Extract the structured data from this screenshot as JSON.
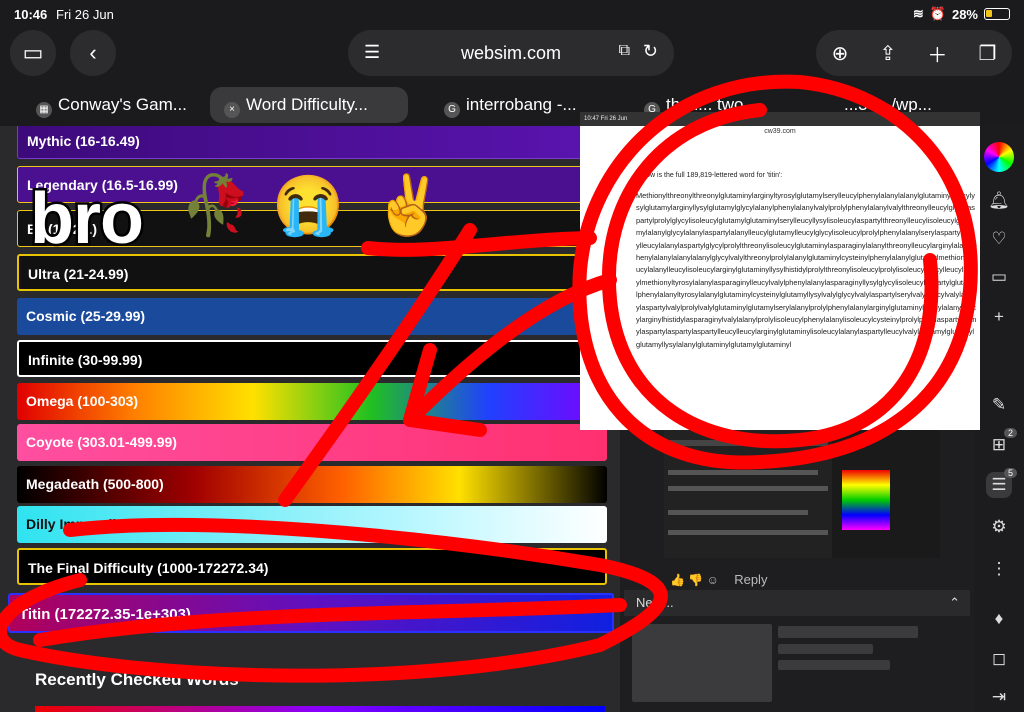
{
  "status": {
    "time": "10:46",
    "date": "Fri 26 Jun",
    "battery": "28%"
  },
  "toolbar": {
    "url": "websim.com"
  },
  "tabs": [
    {
      "label": "Conway's Gam..."
    },
    {
      "label": "Word Difficulty..."
    },
    {
      "label": "interrobang -..."
    },
    {
      "label": "the l...      two"
    },
    {
      "label": "...3 ... /wp..."
    }
  ],
  "difficulties": [
    {
      "label": "Mythic (16-16.49)"
    },
    {
      "label": "Legendary (16.5-16.99)"
    },
    {
      "label": "E...(17-20.)"
    },
    {
      "label": "Ultra (21-24.99)"
    },
    {
      "label": "Cosmic (25-29.99)"
    },
    {
      "label": "Infinite (30-99.99)"
    },
    {
      "label": "Omega (100-303)"
    },
    {
      "label": "Coyote (303.01-499.99)"
    },
    {
      "label": "Megadeath (500-800)"
    },
    {
      "label": "Dilly Impossible (800.01-999.99)"
    },
    {
      "label": "The Final Difficulty (1000-172272.34)"
    },
    {
      "label": "Titin (172272.35-1e+303)"
    }
  ],
  "recent_title": "Recently Checked Words",
  "overlay": {
    "caption": "bro",
    "emojis": [
      "🥀",
      "😭",
      "✌️"
    ],
    "shot_time": "10:47  Fri 26 Jun",
    "shot_url": "cw39.com",
    "shot_intro": "Below is the full 189,819-lettered word for 'titin':",
    "shot_text": "Methionylthreonylthreonylglutaminylarginyltyrosylglutamylserylleucylphenylalanylalanylglutaminylleucylysylglutamylarginyllysylglutamylglycylalanylphenylalanylvalylprolylphenylalanylvalylthreonylleucylglycylaspartylprolylglycylisoleucylglutamylglutaminylserylleucyllysylisoleucylaspartylthreonylleucylisoleucylglutamylalanylglycylalanylaspartylalanylleucylglutamylleucylglycylisoleucylprolylphenylalanylserylaspartylprolylleucylalanylaspartylglycylprolylthreonylisoleucylglutaminylasparaginylalanylthreonylleucylarginylalanylphenylalanylalanylalanylglycylvalylthreonylprolylalanylglutaminylcysteinylphenylalanylglutamylmethionylleucylalanylleucylisoleucylarginylglutaminyllysylhistidylprolylthreonylisoleucylprolylisoleucylglycylleucylleucylmethionyltyrosylalanylasparaginylleucylvalylphenylalanylasparaginyllysylglycylisoleucylaspartylglutamylphenylalanyltyrosylalanylglutaminylcysteinylglutamyllysylvalylglycylvalylaspartylserylvalylleucylvalylalanylaspartylvalylprolylvalylglutaminylglutamylserylalanylprolylphenylalanylarginylglutaminylalanylalanylleucylarginylhistidylasparaginylvalylalanylprolylisoleucylphenylalanylisoleucylcysteinylprolylprolylaspartylalanylaspartylaspartylaspartylleucylleucylarginylglutaminylisoleucylalanylaspartylleucylvalylglutamylglutamylglutamyllysylalanylglutaminylglutamylglutaminyl",
    "reply": "Reply",
    "next": "Next..."
  },
  "sidebar_badges": {
    "tabs": "2",
    "comments": "5"
  }
}
